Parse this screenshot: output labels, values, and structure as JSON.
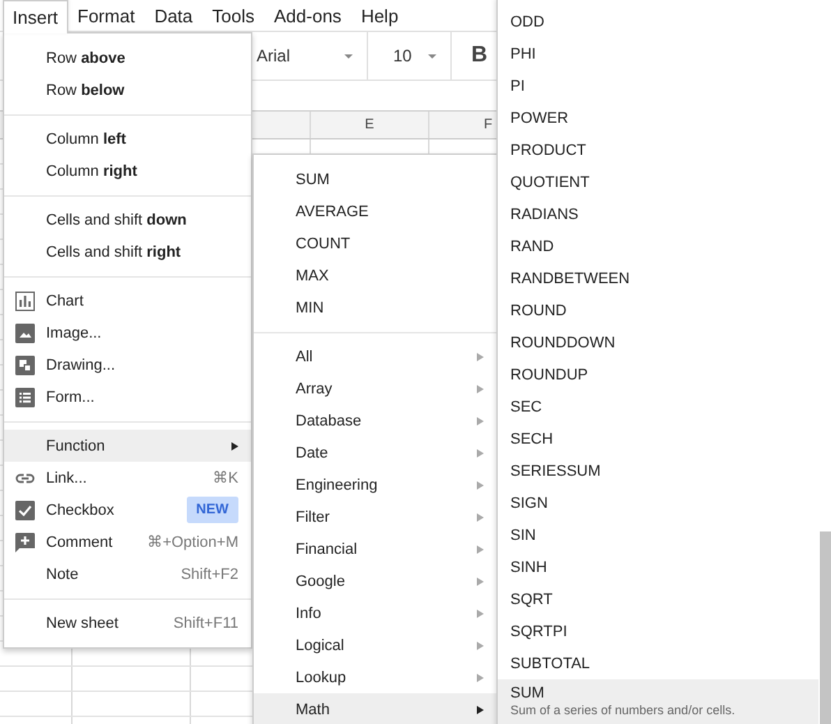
{
  "menubar": [
    {
      "label": "Insert",
      "selected": true
    },
    {
      "label": "Format",
      "selected": false
    },
    {
      "label": "Data",
      "selected": false
    },
    {
      "label": "Tools",
      "selected": false
    },
    {
      "label": "Add-ons",
      "selected": false
    },
    {
      "label": "Help",
      "selected": false
    }
  ],
  "toolbar": {
    "font": "Arial",
    "font_size": "10",
    "bold_button": "B"
  },
  "column_headers": [
    "E",
    "F"
  ],
  "insert_menu": {
    "groups": [
      [
        {
          "kind": "text",
          "label": "Row **above**",
          "selected": false
        },
        {
          "kind": "text",
          "label": "Row **below**",
          "selected": false
        }
      ],
      [
        {
          "kind": "text",
          "label": "Column **left**",
          "selected": false
        },
        {
          "kind": "text",
          "label": "Column **right**",
          "selected": false
        }
      ],
      [
        {
          "kind": "text",
          "label": "Cells and shift **down**",
          "selected": false
        },
        {
          "kind": "text",
          "label": "Cells and shift **right**",
          "selected": false
        }
      ],
      [
        {
          "kind": "chart",
          "label": "Chart",
          "selected": false
        },
        {
          "kind": "image",
          "label": "Image...",
          "selected": false
        },
        {
          "kind": "drawing",
          "label": "Drawing...",
          "selected": false
        },
        {
          "kind": "form",
          "label": "Form...",
          "selected": false
        }
      ],
      [
        {
          "kind": "text",
          "label": "Function",
          "submenu": true,
          "selected": true
        },
        {
          "kind": "link",
          "label": "Link...",
          "shortcut": "⌘K",
          "selected": false
        },
        {
          "kind": "checkbox",
          "label": "Checkbox",
          "badge": "NEW",
          "selected": false
        },
        {
          "kind": "comment",
          "label": "Comment",
          "shortcut": "⌘+Option+M",
          "selected": false
        },
        {
          "kind": "text",
          "label": "Note",
          "shortcut": "Shift+F2",
          "selected": false
        }
      ],
      [
        {
          "kind": "text",
          "label": "New sheet",
          "shortcut": "Shift+F11",
          "selected": false
        }
      ]
    ]
  },
  "function_menu": {
    "recent": [
      "SUM",
      "AVERAGE",
      "COUNT",
      "MAX",
      "MIN"
    ],
    "categories": [
      {
        "label": "All",
        "selected": false
      },
      {
        "label": "Array",
        "selected": false
      },
      {
        "label": "Database",
        "selected": false
      },
      {
        "label": "Date",
        "selected": false
      },
      {
        "label": "Engineering",
        "selected": false
      },
      {
        "label": "Filter",
        "selected": false
      },
      {
        "label": "Financial",
        "selected": false
      },
      {
        "label": "Google",
        "selected": false
      },
      {
        "label": "Info",
        "selected": false
      },
      {
        "label": "Logical",
        "selected": false
      },
      {
        "label": "Lookup",
        "selected": false
      },
      {
        "label": "Math",
        "selected": true
      }
    ]
  },
  "math_menu": {
    "items": [
      {
        "label": "ODD",
        "selected": false
      },
      {
        "label": "PHI",
        "selected": false
      },
      {
        "label": "PI",
        "selected": false
      },
      {
        "label": "POWER",
        "selected": false
      },
      {
        "label": "PRODUCT",
        "selected": false
      },
      {
        "label": "QUOTIENT",
        "selected": false
      },
      {
        "label": "RADIANS",
        "selected": false
      },
      {
        "label": "RAND",
        "selected": false
      },
      {
        "label": "RANDBETWEEN",
        "selected": false
      },
      {
        "label": "ROUND",
        "selected": false
      },
      {
        "label": "ROUNDDOWN",
        "selected": false
      },
      {
        "label": "ROUNDUP",
        "selected": false
      },
      {
        "label": "SEC",
        "selected": false
      },
      {
        "label": "SECH",
        "selected": false
      },
      {
        "label": "SERIESSUM",
        "selected": false
      },
      {
        "label": "SIGN",
        "selected": false
      },
      {
        "label": "SIN",
        "selected": false
      },
      {
        "label": "SINH",
        "selected": false
      },
      {
        "label": "SQRT",
        "selected": false
      },
      {
        "label": "SQRTPI",
        "selected": false
      },
      {
        "label": "SUBTOTAL",
        "selected": false
      },
      {
        "label": "SUM",
        "description": "Sum of a series of numbers and/or cells.",
        "selected": true
      }
    ]
  }
}
